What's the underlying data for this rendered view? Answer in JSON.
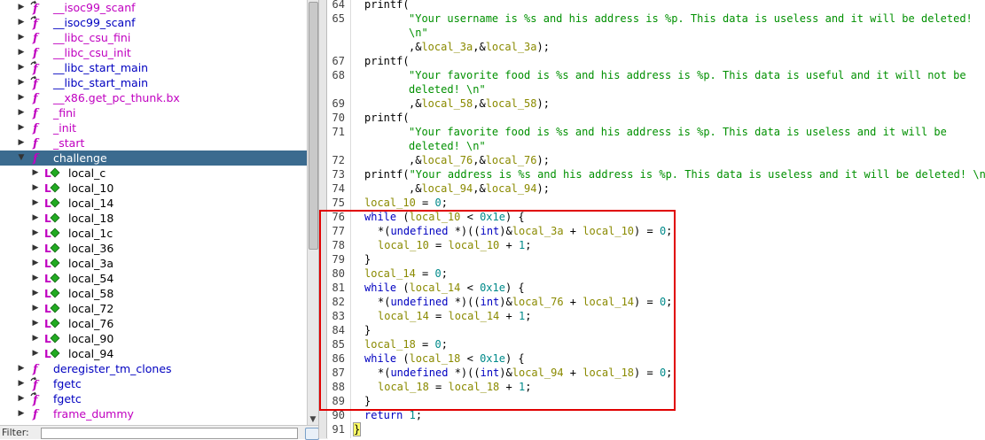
{
  "tree": {
    "items": [
      {
        "label": "__isoc99_scanf",
        "icon": "thunk-function-icon",
        "kind": "ext",
        "twisty": "▶",
        "level": 0
      },
      {
        "label": "__isoc99_scanf",
        "icon": "thunk-function-icon",
        "kind": "fn",
        "twisty": "▶",
        "level": 0
      },
      {
        "label": "__libc_csu_fini",
        "icon": "function-icon",
        "kind": "ext",
        "twisty": "▶",
        "level": 0
      },
      {
        "label": "__libc_csu_init",
        "icon": "function-icon",
        "kind": "ext",
        "twisty": "▶",
        "level": 0
      },
      {
        "label": "__libc_start_main",
        "icon": "thunk-function-icon",
        "kind": "fn",
        "twisty": "▶",
        "level": 0
      },
      {
        "label": "__libc_start_main",
        "icon": "thunk-function-icon",
        "kind": "fn",
        "twisty": "▶",
        "level": 0
      },
      {
        "label": "__x86.get_pc_thunk.bx",
        "icon": "function-icon",
        "kind": "ext",
        "twisty": "▶",
        "level": 0
      },
      {
        "label": "_fini",
        "icon": "function-icon",
        "kind": "ext",
        "twisty": "▶",
        "level": 0
      },
      {
        "label": "_init",
        "icon": "function-icon",
        "kind": "ext",
        "twisty": "▶",
        "level": 0
      },
      {
        "label": "_start",
        "icon": "function-icon",
        "kind": "ext",
        "twisty": "▶",
        "level": 0
      },
      {
        "label": "challenge",
        "icon": "function-icon",
        "kind": "ext",
        "twisty": "▼",
        "level": 0,
        "selected": true
      },
      {
        "label": "local_c",
        "icon": "local-variable-icon",
        "kind": "loc",
        "twisty": "▶",
        "level": 1
      },
      {
        "label": "local_10",
        "icon": "local-variable-icon",
        "kind": "loc",
        "twisty": "▶",
        "level": 1
      },
      {
        "label": "local_14",
        "icon": "local-variable-icon",
        "kind": "loc",
        "twisty": "▶",
        "level": 1
      },
      {
        "label": "local_18",
        "icon": "local-variable-icon",
        "kind": "loc",
        "twisty": "▶",
        "level": 1
      },
      {
        "label": "local_1c",
        "icon": "local-variable-icon",
        "kind": "loc",
        "twisty": "▶",
        "level": 1
      },
      {
        "label": "local_36",
        "icon": "local-variable-icon",
        "kind": "loc",
        "twisty": "▶",
        "level": 1
      },
      {
        "label": "local_3a",
        "icon": "local-variable-icon",
        "kind": "loc",
        "twisty": "▶",
        "level": 1
      },
      {
        "label": "local_54",
        "icon": "local-variable-icon",
        "kind": "loc",
        "twisty": "▶",
        "level": 1
      },
      {
        "label": "local_58",
        "icon": "local-variable-icon",
        "kind": "loc",
        "twisty": "▶",
        "level": 1
      },
      {
        "label": "local_72",
        "icon": "local-variable-icon",
        "kind": "loc",
        "twisty": "▶",
        "level": 1
      },
      {
        "label": "local_76",
        "icon": "local-variable-icon",
        "kind": "loc",
        "twisty": "▶",
        "level": 1
      },
      {
        "label": "local_90",
        "icon": "local-variable-icon",
        "kind": "loc",
        "twisty": "▶",
        "level": 1
      },
      {
        "label": "local_94",
        "icon": "local-variable-icon",
        "kind": "loc",
        "twisty": "▶",
        "level": 1
      },
      {
        "label": "deregister_tm_clones",
        "icon": "function-icon",
        "kind": "fn",
        "twisty": "▶",
        "level": 0
      },
      {
        "label": "fgetc",
        "icon": "thunk-function-icon",
        "kind": "fn",
        "twisty": "▶",
        "level": 0
      },
      {
        "label": "fgetc",
        "icon": "thunk-function-icon",
        "kind": "fn",
        "twisty": "▶",
        "level": 0
      },
      {
        "label": "frame_dummy",
        "icon": "function-icon",
        "kind": "ext",
        "twisty": "▶",
        "level": 0
      }
    ]
  },
  "filter": {
    "label": "Filter:",
    "value": ""
  },
  "code": {
    "lines": [
      {
        "n": "64",
        "indent": 1,
        "tokens": [
          [
            "plain",
            "printf("
          ]
        ]
      },
      {
        "n": "65",
        "indent": 4,
        "tokens": [
          [
            "str",
            "\"Your username is %s and his address is %p. This data is useless and it will be deleted!"
          ]
        ]
      },
      {
        "n": "",
        "indent": 4,
        "tokens": [
          [
            "str",
            "\\n\""
          ]
        ]
      },
      {
        "n": "",
        "indent": 4,
        "tokens": [
          [
            "plain",
            ",&"
          ],
          [
            "var",
            "local_3a"
          ],
          [
            "plain",
            ",&"
          ],
          [
            "var",
            "local_3a"
          ],
          [
            "plain",
            ");"
          ]
        ]
      },
      {
        "n": "67",
        "indent": 1,
        "tokens": [
          [
            "plain",
            "printf("
          ]
        ]
      },
      {
        "n": "68",
        "indent": 4,
        "tokens": [
          [
            "str",
            "\"Your favorite food is %s and his address is %p. This data is useful and it will not be"
          ]
        ]
      },
      {
        "n": "",
        "indent": 4,
        "tokens": [
          [
            "str",
            "deleted! \\n\""
          ]
        ]
      },
      {
        "n": "69",
        "indent": 4,
        "tokens": [
          [
            "plain",
            ",&"
          ],
          [
            "var",
            "local_58"
          ],
          [
            "plain",
            ",&"
          ],
          [
            "var",
            "local_58"
          ],
          [
            "plain",
            ");"
          ]
        ]
      },
      {
        "n": "70",
        "indent": 1,
        "tokens": [
          [
            "plain",
            "printf("
          ]
        ]
      },
      {
        "n": "71",
        "indent": 4,
        "tokens": [
          [
            "str",
            "\"Your favorite food is %s and his address is %p. This data is useless and it will be"
          ]
        ]
      },
      {
        "n": "",
        "indent": 4,
        "tokens": [
          [
            "str",
            "deleted! \\n\""
          ]
        ]
      },
      {
        "n": "72",
        "indent": 4,
        "tokens": [
          [
            "plain",
            ",&"
          ],
          [
            "var",
            "local_76"
          ],
          [
            "plain",
            ",&"
          ],
          [
            "var",
            "local_76"
          ],
          [
            "plain",
            ");"
          ]
        ]
      },
      {
        "n": "73",
        "indent": 1,
        "tokens": [
          [
            "plain",
            "printf("
          ],
          [
            "str",
            "\"Your address is %s and his address is %p. This data is useless and it will be deleted! \\n\""
          ]
        ]
      },
      {
        "n": "74",
        "indent": 4,
        "tokens": [
          [
            "plain",
            ",&"
          ],
          [
            "var",
            "local_94"
          ],
          [
            "plain",
            ",&"
          ],
          [
            "var",
            "local_94"
          ],
          [
            "plain",
            ");"
          ]
        ]
      },
      {
        "n": "75",
        "indent": 1,
        "tokens": [
          [
            "var",
            "local_10"
          ],
          [
            "plain",
            " = "
          ],
          [
            "num",
            "0"
          ],
          [
            "plain",
            ";"
          ]
        ]
      },
      {
        "n": "76",
        "indent": 1,
        "tokens": [
          [
            "kw",
            "while"
          ],
          [
            "plain",
            " ("
          ],
          [
            "var",
            "local_10"
          ],
          [
            "plain",
            " < "
          ],
          [
            "num",
            "0x1e"
          ],
          [
            "plain",
            ") {"
          ]
        ]
      },
      {
        "n": "77",
        "indent": 2,
        "tokens": [
          [
            "plain",
            "*("
          ],
          [
            "kw",
            "undefined"
          ],
          [
            "plain",
            " *)(("
          ],
          [
            "kw",
            "int"
          ],
          [
            "plain",
            ")&"
          ],
          [
            "var",
            "local_3a"
          ],
          [
            "plain",
            " + "
          ],
          [
            "var",
            "local_10"
          ],
          [
            "plain",
            ") = "
          ],
          [
            "num",
            "0"
          ],
          [
            "plain",
            ";"
          ]
        ]
      },
      {
        "n": "78",
        "indent": 2,
        "tokens": [
          [
            "var",
            "local_10"
          ],
          [
            "plain",
            " = "
          ],
          [
            "var",
            "local_10"
          ],
          [
            "plain",
            " + "
          ],
          [
            "num",
            "1"
          ],
          [
            "plain",
            ";"
          ]
        ]
      },
      {
        "n": "79",
        "indent": 1,
        "tokens": [
          [
            "plain",
            "}"
          ]
        ]
      },
      {
        "n": "80",
        "indent": 1,
        "tokens": [
          [
            "var",
            "local_14"
          ],
          [
            "plain",
            " = "
          ],
          [
            "num",
            "0"
          ],
          [
            "plain",
            ";"
          ]
        ]
      },
      {
        "n": "81",
        "indent": 1,
        "tokens": [
          [
            "kw",
            "while"
          ],
          [
            "plain",
            " ("
          ],
          [
            "var",
            "local_14"
          ],
          [
            "plain",
            " < "
          ],
          [
            "num",
            "0x1e"
          ],
          [
            "plain",
            ") {"
          ]
        ]
      },
      {
        "n": "82",
        "indent": 2,
        "tokens": [
          [
            "plain",
            "*("
          ],
          [
            "kw",
            "undefined"
          ],
          [
            "plain",
            " *)(("
          ],
          [
            "kw",
            "int"
          ],
          [
            "plain",
            ")&"
          ],
          [
            "var",
            "local_76"
          ],
          [
            "plain",
            " + "
          ],
          [
            "var",
            "local_14"
          ],
          [
            "plain",
            ") = "
          ],
          [
            "num",
            "0"
          ],
          [
            "plain",
            ";"
          ]
        ]
      },
      {
        "n": "83",
        "indent": 2,
        "tokens": [
          [
            "var",
            "local_14"
          ],
          [
            "plain",
            " = "
          ],
          [
            "var",
            "local_14"
          ],
          [
            "plain",
            " + "
          ],
          [
            "num",
            "1"
          ],
          [
            "plain",
            ";"
          ]
        ]
      },
      {
        "n": "84",
        "indent": 1,
        "tokens": [
          [
            "plain",
            "}"
          ]
        ]
      },
      {
        "n": "85",
        "indent": 1,
        "tokens": [
          [
            "var",
            "local_18"
          ],
          [
            "plain",
            " = "
          ],
          [
            "num",
            "0"
          ],
          [
            "plain",
            ";"
          ]
        ]
      },
      {
        "n": "86",
        "indent": 1,
        "tokens": [
          [
            "kw",
            "while"
          ],
          [
            "plain",
            " ("
          ],
          [
            "var",
            "local_18"
          ],
          [
            "plain",
            " < "
          ],
          [
            "num",
            "0x1e"
          ],
          [
            "plain",
            ") {"
          ]
        ]
      },
      {
        "n": "87",
        "indent": 2,
        "tokens": [
          [
            "plain",
            "*("
          ],
          [
            "kw",
            "undefined"
          ],
          [
            "plain",
            " *)(("
          ],
          [
            "kw",
            "int"
          ],
          [
            "plain",
            ")&"
          ],
          [
            "var",
            "local_94"
          ],
          [
            "plain",
            " + "
          ],
          [
            "var",
            "local_18"
          ],
          [
            "plain",
            ") = "
          ],
          [
            "num",
            "0"
          ],
          [
            "plain",
            ";"
          ]
        ]
      },
      {
        "n": "88",
        "indent": 2,
        "tokens": [
          [
            "var",
            "local_18"
          ],
          [
            "plain",
            " = "
          ],
          [
            "var",
            "local_18"
          ],
          [
            "plain",
            " + "
          ],
          [
            "num",
            "1"
          ],
          [
            "plain",
            ";"
          ]
        ]
      },
      {
        "n": "89",
        "indent": 1,
        "tokens": [
          [
            "plain",
            "}"
          ]
        ]
      },
      {
        "n": "90",
        "indent": 1,
        "tokens": [
          [
            "kw",
            "return"
          ],
          [
            "plain",
            " "
          ],
          [
            "num",
            "1"
          ],
          [
            "plain",
            ";"
          ]
        ]
      },
      {
        "n": "91",
        "indent": 0,
        "tokens": [
          [
            "plain",
            "}"
          ]
        ]
      }
    ]
  },
  "colors": {
    "selection": "#3b6b8f",
    "highlight_box": "#e00000",
    "keyword": "#0000c0",
    "variable": "#8a8a00",
    "string": "#009000",
    "number": "#008a8a"
  }
}
